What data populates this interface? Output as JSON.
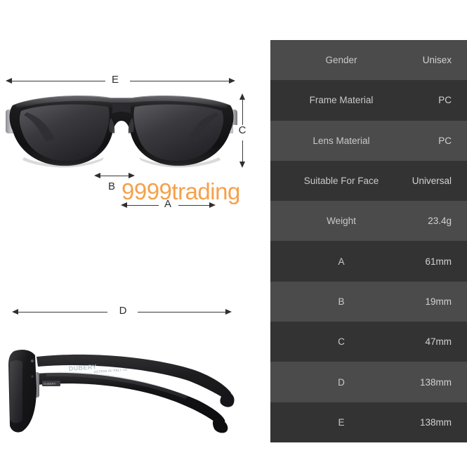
{
  "page": {
    "background": "#ffffff",
    "watermark": "9999trading",
    "watermark_color": "#f5a14b"
  },
  "diagrams": {
    "front_view": {
      "name": "sunglasses-front-view",
      "alt": "Black square frame polarized sunglasses, front view"
    },
    "side_view": {
      "name": "sunglasses-side-view",
      "alt": "Black sunglasses side view showing temple arms and hinge",
      "temple_brand_text": "DUBERY",
      "temple_sub_text": "DESIGN IN ITALY CE"
    },
    "dimension_labels": {
      "E": "E",
      "C": "C",
      "B": "B",
      "A": "A",
      "D": "D"
    }
  },
  "spec_table": {
    "rows": [
      {
        "key": "Gender",
        "value": "Unisex"
      },
      {
        "key": "Frame Material",
        "value": "PC"
      },
      {
        "key": "Lens Material",
        "value": "PC"
      },
      {
        "key": "Suitable For Face",
        "value": "Universal"
      },
      {
        "key": "Weight",
        "value": "23.4g"
      },
      {
        "key": "A",
        "value": "61mm"
      },
      {
        "key": "B",
        "value": "19mm"
      },
      {
        "key": "C",
        "value": "47mm"
      },
      {
        "key": "D",
        "value": "138mm"
      },
      {
        "key": "E",
        "value": "138mm"
      }
    ],
    "row_color_odd": "#4b4b4b",
    "row_color_even": "#333333",
    "text_color": "#c9c9c9"
  }
}
